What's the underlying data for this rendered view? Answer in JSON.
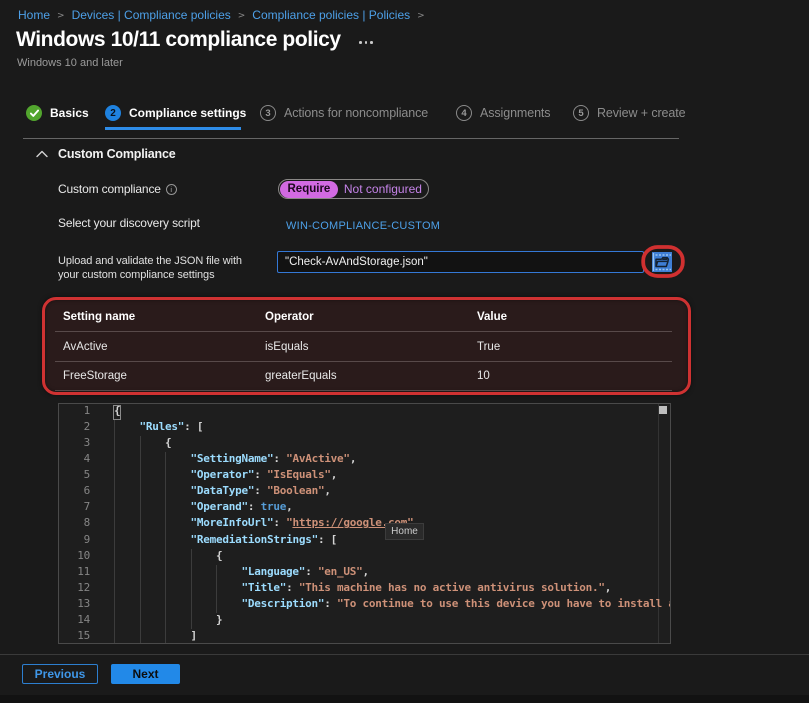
{
  "breadcrumb": {
    "items": [
      "Home",
      "Devices | Compliance policies",
      "Compliance policies | Policies"
    ],
    "separator": ">"
  },
  "header": {
    "title": "Windows 10/11 compliance policy",
    "subtitle": "Windows 10 and later",
    "more_menu": "..."
  },
  "steps": [
    {
      "label": "Basics",
      "state": "done"
    },
    {
      "label": "Compliance settings",
      "state": "active",
      "number": "2"
    },
    {
      "label": "Actions for noncompliance",
      "state": "todo",
      "number": "3"
    },
    {
      "label": "Assignments",
      "state": "todo",
      "number": "4"
    },
    {
      "label": "Review + create",
      "state": "todo",
      "number": "5"
    }
  ],
  "section": {
    "title": "Custom Compliance"
  },
  "form": {
    "custom_compliance_label": "Custom compliance",
    "info_icon": "i",
    "toggle_on_label": "Require",
    "toggle_off_label": "Not configured",
    "discovery_script_label": "Select your discovery script",
    "discovery_script_value": "WIN-COMPLIANCE-CUSTOM",
    "upload_label_line1": "Upload and validate the JSON file with",
    "upload_label_line2": "your custom compliance settings",
    "upload_value": "\"Check-AvAndStorage.json\""
  },
  "table": {
    "headers": [
      "Setting name",
      "Operator",
      "Value"
    ],
    "rows": [
      {
        "setting": "AvActive",
        "operator": "isEquals",
        "value": "True"
      },
      {
        "setting": "FreeStorage",
        "operator": "greaterEquals",
        "value": "10"
      }
    ]
  },
  "editor": {
    "tooltip": "Home",
    "lines": [
      {
        "num": "1",
        "guides": [],
        "cursor": true,
        "tokens": [
          [
            "p",
            "{"
          ]
        ]
      },
      {
        "num": "2",
        "guides": [
          0
        ],
        "tokens": [
          [
            "p",
            "    "
          ],
          [
            "k",
            "\"Rules\""
          ],
          [
            "p",
            ": ["
          ]
        ]
      },
      {
        "num": "3",
        "guides": [
          0,
          4
        ],
        "tokens": [
          [
            "p",
            "        {"
          ]
        ]
      },
      {
        "num": "4",
        "guides": [
          0,
          4,
          8
        ],
        "tokens": [
          [
            "p",
            "            "
          ],
          [
            "k",
            "\"SettingName\""
          ],
          [
            "p",
            ": "
          ],
          [
            "s",
            "\"AvActive\""
          ],
          [
            "p",
            ","
          ]
        ]
      },
      {
        "num": "5",
        "guides": [
          0,
          4,
          8
        ],
        "tokens": [
          [
            "p",
            "            "
          ],
          [
            "k",
            "\"Operator\""
          ],
          [
            "p",
            ": "
          ],
          [
            "s",
            "\"IsEquals\""
          ],
          [
            "p",
            ","
          ]
        ]
      },
      {
        "num": "6",
        "guides": [
          0,
          4,
          8
        ],
        "tokens": [
          [
            "p",
            "            "
          ],
          [
            "k",
            "\"DataType\""
          ],
          [
            "p",
            ": "
          ],
          [
            "s",
            "\"Boolean\""
          ],
          [
            "p",
            ","
          ]
        ]
      },
      {
        "num": "7",
        "guides": [
          0,
          4,
          8
        ],
        "tokens": [
          [
            "p",
            "            "
          ],
          [
            "k",
            "\"Operand\""
          ],
          [
            "p",
            ": "
          ],
          [
            "w",
            "true"
          ],
          [
            "p",
            ","
          ]
        ]
      },
      {
        "num": "8",
        "guides": [
          0,
          4,
          8
        ],
        "tokens": [
          [
            "p",
            "            "
          ],
          [
            "k",
            "\"MoreInfoUrl\""
          ],
          [
            "p",
            ": "
          ],
          [
            "s",
            "\""
          ],
          [
            "u",
            "https://google.com"
          ],
          [
            "s",
            "\""
          ],
          [
            "p",
            ","
          ]
        ]
      },
      {
        "num": "9",
        "guides": [
          0,
          4,
          8
        ],
        "tokens": [
          [
            "p",
            "            "
          ],
          [
            "k",
            "\"RemediationStrings\""
          ],
          [
            "p",
            ": ["
          ]
        ]
      },
      {
        "num": "10",
        "guides": [
          0,
          4,
          8,
          12
        ],
        "tokens": [
          [
            "p",
            "                {"
          ]
        ]
      },
      {
        "num": "11",
        "guides": [
          0,
          4,
          8,
          12,
          16
        ],
        "tokens": [
          [
            "p",
            "                    "
          ],
          [
            "k",
            "\"Language\""
          ],
          [
            "p",
            ": "
          ],
          [
            "s",
            "\"en_US\""
          ],
          [
            "p",
            ","
          ]
        ]
      },
      {
        "num": "12",
        "guides": [
          0,
          4,
          8,
          12,
          16
        ],
        "tokens": [
          [
            "p",
            "                    "
          ],
          [
            "k",
            "\"Title\""
          ],
          [
            "p",
            ": "
          ],
          [
            "s",
            "\"This machine has no active antivirus solution.\""
          ],
          [
            "p",
            ","
          ]
        ]
      },
      {
        "num": "13",
        "guides": [
          0,
          4,
          8,
          12,
          16
        ],
        "tokens": [
          [
            "p",
            "                    "
          ],
          [
            "k",
            "\"Description\""
          ],
          [
            "p",
            ": "
          ],
          [
            "s",
            "\"To continue to use this device you have to install an antivirus solution.\""
          ]
        ]
      },
      {
        "num": "14",
        "guides": [
          0,
          4,
          8,
          12
        ],
        "tokens": [
          [
            "p",
            "                }"
          ]
        ]
      },
      {
        "num": "15",
        "guides": [
          0,
          4,
          8
        ],
        "tokens": [
          [
            "p",
            "            ]"
          ]
        ]
      }
    ]
  },
  "footer": {
    "previous_label": "Previous",
    "next_label": "Next"
  },
  "colors": {
    "accent_blue": "#2e8ce8",
    "link_blue": "#4da0e8",
    "toggle_magenta": "#d26ae2",
    "annotation_red": "#cf3232",
    "done_green": "#52a52e"
  }
}
